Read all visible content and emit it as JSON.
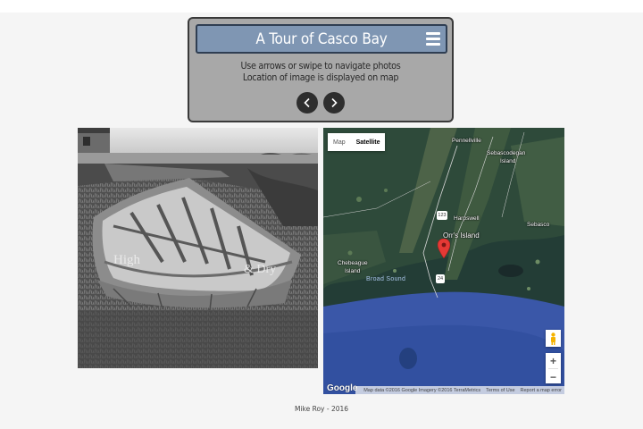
{
  "header": {
    "title": "A Tour of Casco Bay",
    "instruction_line1": "Use arrows or swipe to navigate photos",
    "instruction_line2": "Location of image is displayed on map"
  },
  "icons": {
    "menu": "hamburger-icon",
    "prev": "chevron-left-icon",
    "next": "chevron-right-icon",
    "marker": "map-pin-icon",
    "pegman": "pegman-icon"
  },
  "photo": {
    "overlay_text_left": "High",
    "overlay_text_right": "& Dry"
  },
  "map": {
    "type_options": [
      "Map",
      "Satellite"
    ],
    "selected_type": "Satellite",
    "labels": {
      "pennellville": "Pennellville",
      "sebascodegan": "Sebascodegan",
      "sebascodegan2": "Island",
      "harpswell": "Harpswell",
      "orrs_island": "Orr's Island",
      "sebasco": "Sebasco",
      "chebeague1": "Chebeague",
      "chebeague2": "Island",
      "broad_sound": "Broad Sound",
      "route_123": "123",
      "route_24": "24"
    },
    "zoom_in": "+",
    "zoom_out": "−",
    "google": "Google",
    "attribution": "Map data ©2016 Google Imagery ©2016 TerraMetrics",
    "terms": "Terms of Use",
    "report": "Report a map error"
  },
  "footer": {
    "credit": "Mike Roy - 2016"
  },
  "colors": {
    "title_bar": "#7f96b3",
    "panel": "#a8a8a8",
    "nav_button": "#2e2e2e",
    "marker": "#e53935"
  }
}
